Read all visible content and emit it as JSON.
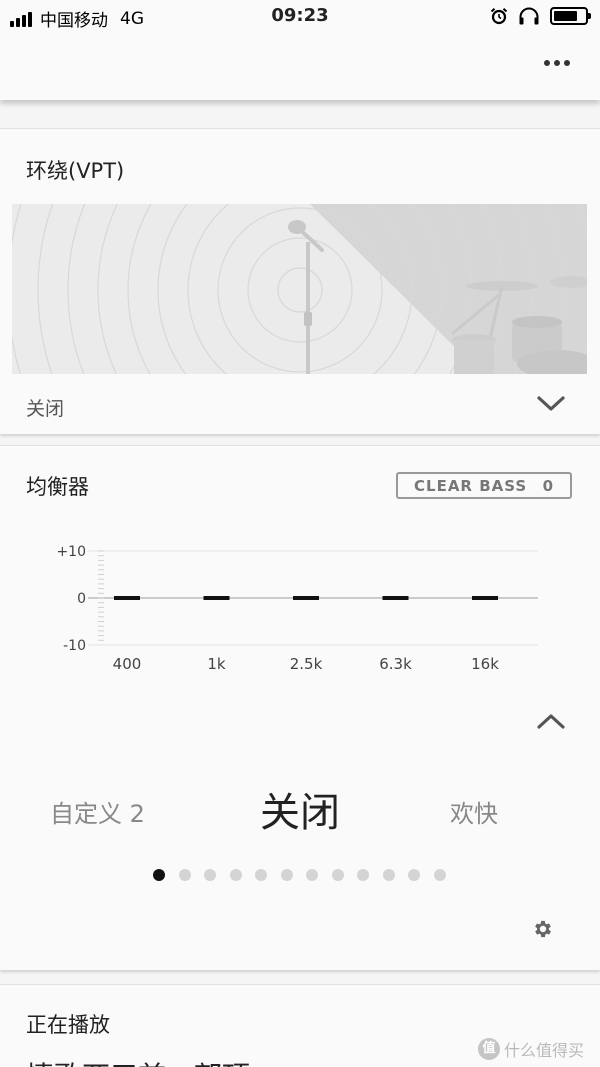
{
  "status_bar": {
    "carrier": "中国移动",
    "network": "4G",
    "time": "09:23"
  },
  "surround": {
    "title": "环绕(VPT)",
    "value": "关闭"
  },
  "equalizer": {
    "title": "均衡器",
    "clear_bass_label": "CLEAR BASS",
    "clear_bass_value": "0",
    "y_ticks": [
      "+10",
      "0",
      "-10"
    ],
    "bands": [
      {
        "label": "400",
        "value": 0
      },
      {
        "label": "1k",
        "value": 0
      },
      {
        "label": "2.5k",
        "value": 0
      },
      {
        "label": "6.3k",
        "value": 0
      },
      {
        "label": "16k",
        "value": 0
      }
    ],
    "y_range": [
      -10,
      10
    ],
    "presets": {
      "previous": "自定义 2",
      "current": "关闭",
      "next": "欢快"
    },
    "page_count": 12,
    "active_page_index": 0
  },
  "now_playing": {
    "title": "正在播放",
    "song": "情歌两三首 - 郭顶"
  },
  "watermark": {
    "logo_char": "值",
    "text": "什么值得买"
  },
  "icons": {
    "more": "more-horizontal-icon",
    "expand": "chevron-down-icon",
    "collapse": "chevron-up-icon",
    "settings": "gear-icon",
    "alarm": "alarm-icon",
    "headphones": "headphones-icon",
    "battery": "battery-icon",
    "signal": "signal-icon"
  },
  "colors": {
    "background": "#f5f5f5",
    "card": "#fafafa",
    "text": "#222222",
    "muted": "#888888",
    "active_dot": "#111111",
    "inactive_dot": "#d4d4d4"
  }
}
